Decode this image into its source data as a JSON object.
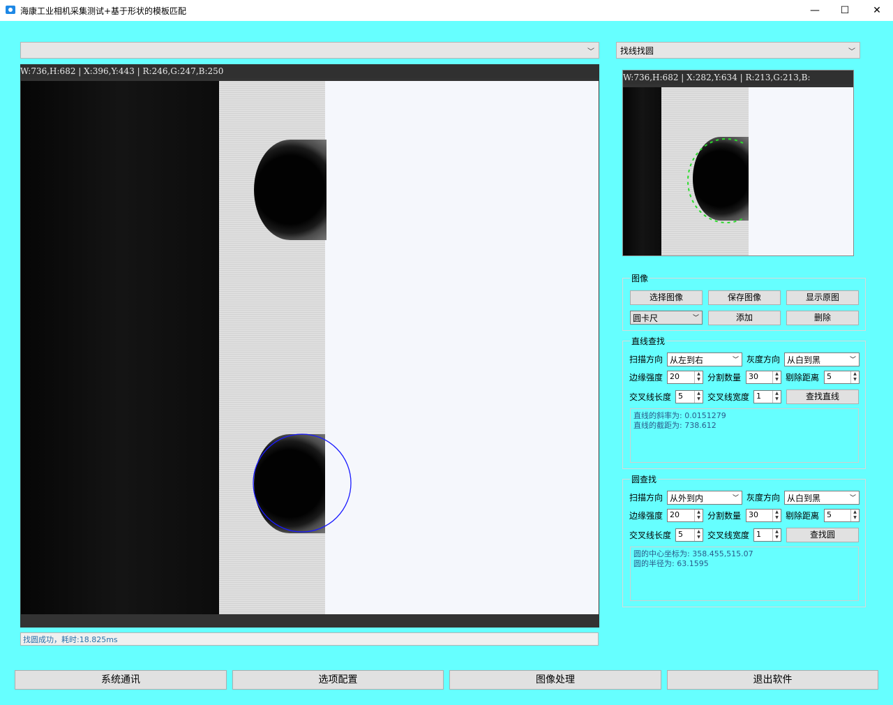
{
  "window": {
    "title": "海康工业相机采集测试+基于形状的模板匹配",
    "minimize": "—",
    "maximize": "☐",
    "close": "✕"
  },
  "main_viewer": {
    "camera_select": "",
    "info": "W:736,H:682 | X:396,Y:443 | R:246,G:247,B:250"
  },
  "status_text": "找圆成功，耗时:18.825ms",
  "mode_select": "找线找圆",
  "preview": {
    "info": "W:736,H:682 | X:282,Y:634 | R:213,G:213,B:"
  },
  "image_group": {
    "title": "图像",
    "select_image": "选择图像",
    "save_image": "保存图像",
    "show_original": "显示原图",
    "tool_select": "圆卡尺",
    "add": "添加",
    "delete": "删除"
  },
  "line_group": {
    "title": "直线查找",
    "scan_dir_label": "扫描方向",
    "scan_dir_value": "从左到右",
    "gray_dir_label": "灰度方向",
    "gray_dir_value": "从白到黑",
    "edge_strength_label": "边缘强度",
    "edge_strength_value": "20",
    "split_count_label": "分割数量",
    "split_count_value": "30",
    "reject_dist_label": "剔除距离",
    "reject_dist_value": "5",
    "cross_len_label": "交叉线长度",
    "cross_len_value": "5",
    "cross_width_label": "交叉线宽度",
    "cross_width_value": "1",
    "find_button": "查找直线",
    "result_line1": "直线的斜率为: 0.0151279",
    "result_line2": "直线的截距为: 738.612"
  },
  "circle_group": {
    "title": "圆查找",
    "scan_dir_label": "扫描方向",
    "scan_dir_value": "从外到内",
    "gray_dir_label": "灰度方向",
    "gray_dir_value": "从白到黑",
    "edge_strength_label": "边缘强度",
    "edge_strength_value": "20",
    "split_count_label": "分割数量",
    "split_count_value": "30",
    "reject_dist_label": "剔除距离",
    "reject_dist_value": "5",
    "cross_len_label": "交叉线长度",
    "cross_len_value": "5",
    "cross_width_label": "交叉线宽度",
    "cross_width_value": "1",
    "find_button": "查找圆",
    "result_line1": "圆的中心坐标为: 358.455,515.07",
    "result_line2": "圆的半径为: 63.1595"
  },
  "bottom_nav": {
    "comm": "系统通讯",
    "options": "选项配置",
    "image_proc": "图像处理",
    "exit": "退出软件"
  },
  "colors": {
    "background": "#66ffff",
    "circle_overlay": "#1a1aff",
    "edge_points": "#2adc2a"
  }
}
